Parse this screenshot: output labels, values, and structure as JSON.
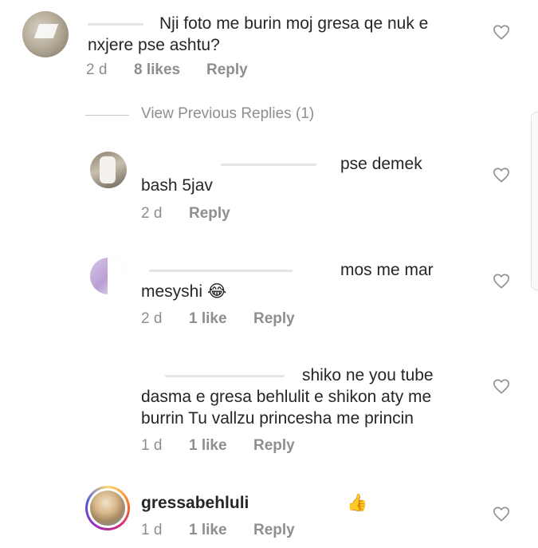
{
  "view_previous_replies": "View Previous Replies (1)",
  "comments": [
    {
      "line1": "Nji foto me burin moj gresa qe nuk e",
      "line2": "nxjere pse ashtu?",
      "time": "2 d",
      "likes": "8 likes",
      "reply": "Reply"
    },
    {
      "line1": "pse demek",
      "line2": "bash 5jav",
      "time": "2 d",
      "reply": "Reply"
    },
    {
      "line1": "mos me mar",
      "line2": "mesyshi 😂",
      "time": "2 d",
      "likes": "1 like",
      "reply": "Reply"
    },
    {
      "line1": "shiko ne you tube",
      "line2": "dasma e gresa behlulit e shikon aty me",
      "line3": "burrin Tu vallzu princesha me princin",
      "time": "1 d",
      "likes": "1 like",
      "reply": "Reply"
    },
    {
      "username": "gressabehluli",
      "emoji": "👍",
      "time": "1 d",
      "likes": "1 like",
      "reply": "Reply"
    }
  ]
}
